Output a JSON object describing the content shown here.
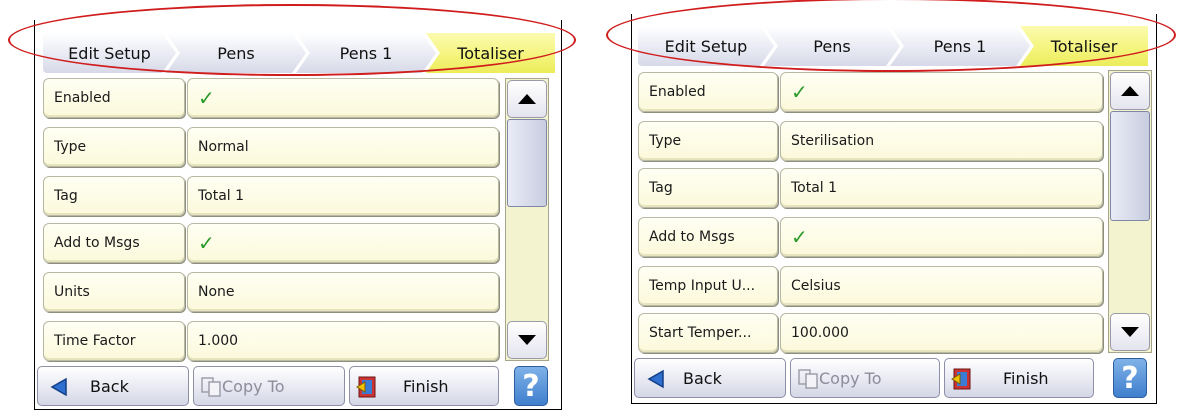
{
  "screens": [
    {
      "breadcrumb": [
        "Edit Setup",
        "Pens",
        "Pens 1",
        "Totaliser"
      ],
      "rows": [
        {
          "label": "Enabled",
          "value": "✓",
          "check": true
        },
        {
          "label": "Type",
          "value": "Normal"
        },
        {
          "label": "Tag",
          "value": "Total 1"
        },
        {
          "label": "Add to Msgs",
          "value": "✓",
          "check": true
        },
        {
          "label": "Units",
          "value": "None"
        },
        {
          "label": "Time Factor",
          "value": "1.000"
        }
      ],
      "footer": {
        "back": "Back",
        "copy_to": "Copy To",
        "finish": "Finish",
        "help": "?"
      }
    },
    {
      "breadcrumb": [
        "Edit Setup",
        "Pens",
        "Pens 1",
        "Totaliser"
      ],
      "rows": [
        {
          "label": "Enabled",
          "value": "✓",
          "check": true
        },
        {
          "label": "Type",
          "value": "Sterilisation"
        },
        {
          "label": "Tag",
          "value": "Total 1"
        },
        {
          "label": "Add to Msgs",
          "value": "✓",
          "check": true
        },
        {
          "label": "Temp Input U...",
          "value": "Celsius"
        },
        {
          "label": "Start Temper...",
          "value": "100.000"
        }
      ],
      "footer": {
        "back": "Back",
        "copy_to": "Copy To",
        "finish": "Finish",
        "help": "?"
      }
    }
  ],
  "colors": {
    "active_crumb": "#f4f47a",
    "row_bg": "#fbf9da",
    "highlight_oval": "#d01c1c",
    "check": "#2a9a2a",
    "help_button": "#3f7fcd"
  },
  "icons": {
    "back": "left-arrow-icon",
    "copy_to": "copy-icon",
    "finish": "finish-door-icon",
    "scroll_up": "triangle-up-icon",
    "scroll_down": "triangle-down-icon"
  }
}
